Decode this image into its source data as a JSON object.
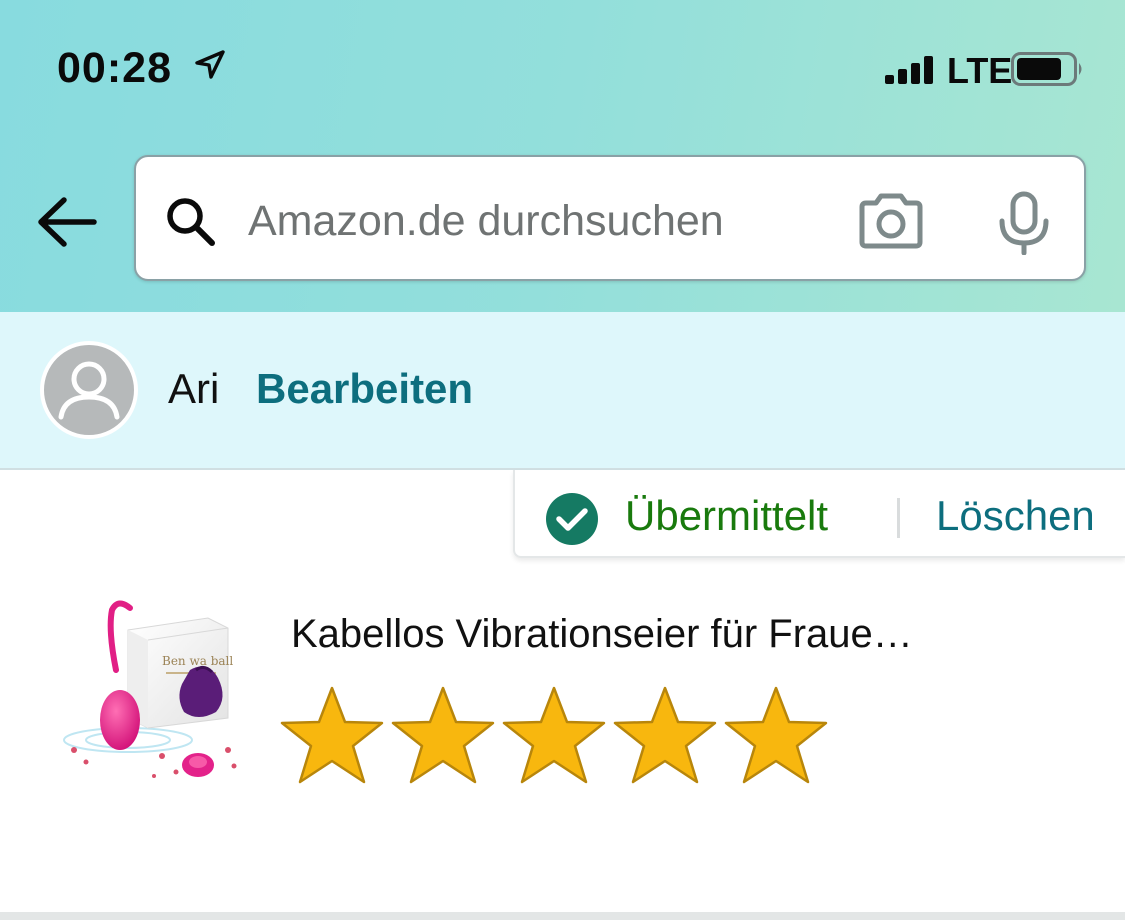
{
  "status_bar": {
    "time": "00:28",
    "network": "LTE",
    "location_icon": "location-arrow-icon",
    "signal_icon": "cellular-signal-icon",
    "battery_icon": "battery-icon"
  },
  "nav": {
    "back_icon": "back-arrow-icon"
  },
  "search": {
    "placeholder": "Amazon.de durchsuchen",
    "search_icon": "search-icon",
    "camera_icon": "camera-icon",
    "mic_icon": "microphone-icon"
  },
  "profile": {
    "name": "Ari",
    "edit_label": "Bearbeiten",
    "avatar_icon": "user-avatar-icon"
  },
  "review_status": {
    "status_label": "Übermittelt",
    "delete_label": "Löschen",
    "check_icon": "check-circle-icon"
  },
  "product": {
    "title": "Kabellos Vibrationseier für Fraue…",
    "image_label": "Ben wa ball",
    "rating": 5,
    "rating_max": 5
  },
  "colors": {
    "link": "#0d6e7e",
    "success": "#197a0d",
    "star": "#f8b70e",
    "header_gradient_start": "#88dbdf",
    "header_gradient_end": "#a8e6d2",
    "profile_bg": "#def7fb"
  }
}
